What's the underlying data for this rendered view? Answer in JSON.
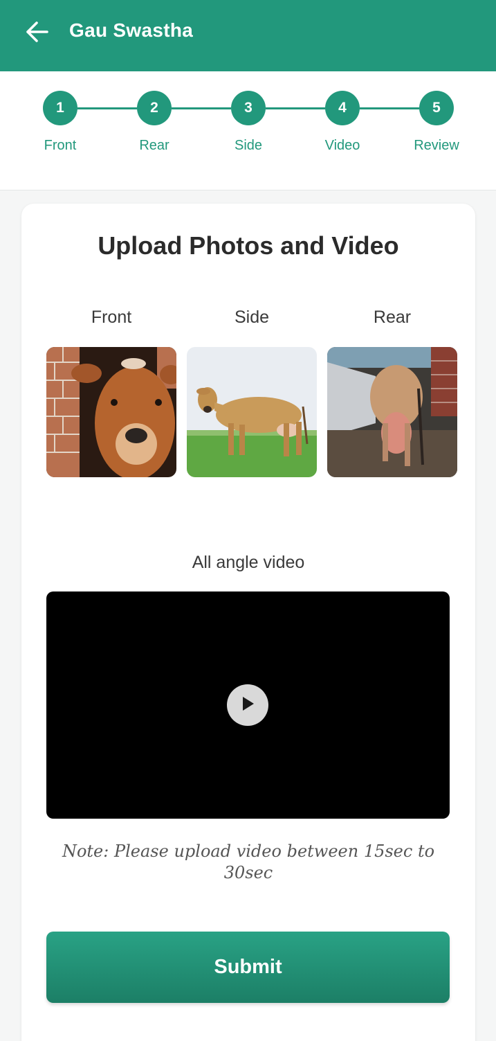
{
  "appbar": {
    "title": "Gau Swastha",
    "back_icon": "arrow-left-icon"
  },
  "stepper": {
    "steps": [
      {
        "number": "1",
        "label": "Front"
      },
      {
        "number": "2",
        "label": "Rear"
      },
      {
        "number": "3",
        "label": "Side"
      },
      {
        "number": "4",
        "label": "Video"
      },
      {
        "number": "5",
        "label": "Review"
      }
    ]
  },
  "card": {
    "title": "Upload Photos and Video",
    "photos": [
      {
        "label": "Front"
      },
      {
        "label": "Side"
      },
      {
        "label": "Rear"
      }
    ],
    "video_label": "All angle video",
    "play_icon": "play-icon",
    "note": "Note: Please upload video between 15sec to 30sec",
    "submit_label": "Submit"
  },
  "colors": {
    "primary": "#22987c",
    "video_bg": "#000000"
  }
}
